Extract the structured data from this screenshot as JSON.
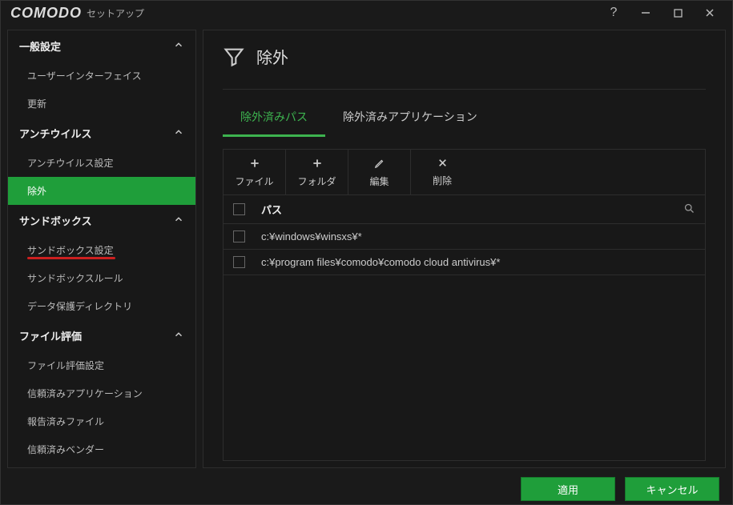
{
  "titlebar": {
    "logo": "COMODO",
    "subtitle": "セットアップ"
  },
  "sidebar": {
    "sections": [
      {
        "header": "一般設定",
        "items": [
          {
            "label": "ユーザーインターフェイス",
            "active": false,
            "marked": false
          },
          {
            "label": "更新",
            "active": false,
            "marked": false
          }
        ]
      },
      {
        "header": "アンチウイルス",
        "items": [
          {
            "label": "アンチウイルス設定",
            "active": false,
            "marked": false
          },
          {
            "label": "除外",
            "active": true,
            "marked": false
          }
        ]
      },
      {
        "header": "サンドボックス",
        "items": [
          {
            "label": "サンドボックス設定",
            "active": false,
            "marked": true
          },
          {
            "label": "サンドボックスルール",
            "active": false,
            "marked": false
          },
          {
            "label": "データ保護ディレクトリ",
            "active": false,
            "marked": false
          }
        ]
      },
      {
        "header": "ファイル評価",
        "items": [
          {
            "label": "ファイル評価設定",
            "active": false,
            "marked": false
          },
          {
            "label": "信頼済みアプリケーション",
            "active": false,
            "marked": false
          },
          {
            "label": "報告済みファイル",
            "active": false,
            "marked": false
          },
          {
            "label": "信頼済みベンダー",
            "active": false,
            "marked": false
          }
        ]
      }
    ]
  },
  "content": {
    "title": "除外",
    "tabs": [
      {
        "label": "除外済みパス",
        "active": true
      },
      {
        "label": "除外済みアプリケーション",
        "active": false
      }
    ],
    "toolbar": [
      {
        "icon": "plus",
        "label": "ファイル"
      },
      {
        "icon": "plus",
        "label": "フォルダ"
      },
      {
        "icon": "pencil",
        "label": "編集"
      },
      {
        "icon": "x",
        "label": "削除"
      }
    ],
    "table": {
      "path_header": "パス",
      "rows": [
        {
          "path": "c:¥windows¥winsxs¥*"
        },
        {
          "path": "c:¥program files¥comodo¥comodo cloud antivirus¥*"
        }
      ]
    }
  },
  "footer": {
    "apply": "適用",
    "cancel": "キャンセル"
  }
}
